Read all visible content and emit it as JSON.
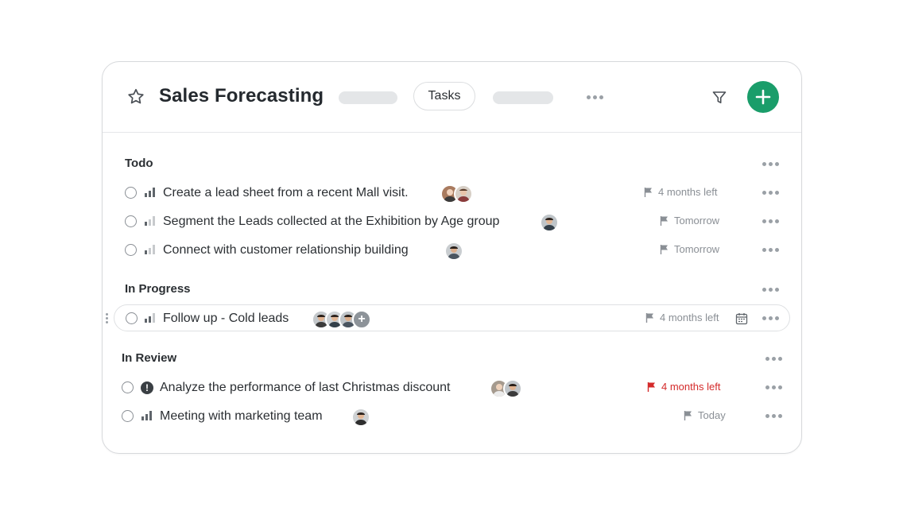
{
  "header": {
    "title": "Sales Forecasting",
    "tab_label": "Tasks",
    "add_button_color": "#1a9d6a"
  },
  "sections": [
    {
      "title": "Todo",
      "tasks": [
        {
          "label": "Create a lead sheet from a recent Mall visit.",
          "due": "4 months left",
          "priority": "high",
          "assignees": 2
        },
        {
          "label": "Segment the Leads collected at the Exhibition by Age group",
          "due": "Tomorrow",
          "priority": "low",
          "assignees": 1
        },
        {
          "label": "Connect with customer relationship building",
          "due": "Tomorrow",
          "priority": "low",
          "assignees": 1
        }
      ]
    },
    {
      "title": "In Progress",
      "tasks": [
        {
          "label": "Follow up - Cold leads",
          "due": "4 months left",
          "priority": "medium",
          "assignees": 3,
          "more_assignees": "+"
        }
      ]
    },
    {
      "title": "In Review",
      "tasks": [
        {
          "label": "Analyze the performance of last Christmas discount",
          "due": "4 months left",
          "priority": "urgent",
          "assignees": 2,
          "overdue_color": "#d42b2b"
        },
        {
          "label": "Meeting with marketing team",
          "due": "Today",
          "priority": "high",
          "assignees": 1
        }
      ]
    }
  ],
  "icons": [
    "star-icon",
    "filter-icon",
    "plus-icon",
    "more-icon",
    "flag-icon",
    "calendar-icon",
    "priority-bars-icon",
    "alert-icon",
    "drag-handle-icon"
  ]
}
